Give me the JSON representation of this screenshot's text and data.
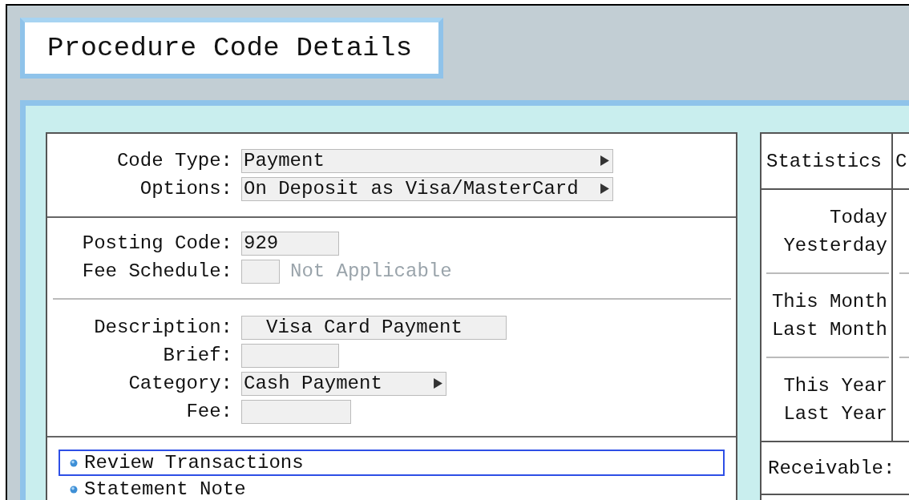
{
  "title": "Procedure Code Details",
  "code_rows": [
    {
      "label": "Code Type:",
      "value": "Payment"
    },
    {
      "label": "Options:",
      "value": "On Deposit as Visa/MasterCard"
    }
  ],
  "posting_rows": [
    {
      "label": "Posting Code:",
      "value": "929"
    },
    {
      "label": "Fee Schedule:",
      "note": "Not Applicable",
      "note_disabled": true
    }
  ],
  "detail_rows": [
    {
      "label": "Description:",
      "kind": "text",
      "value": "Visa Card Payment"
    },
    {
      "label": "Brief:",
      "kind": "text"
    },
    {
      "label": "Category:",
      "kind": "dropdown",
      "value": "Cash Payment"
    },
    {
      "label": "Fee:",
      "kind": "text"
    }
  ],
  "actions": [
    {
      "label": "Review Transactions",
      "selected": true
    },
    {
      "label": "Statement Note",
      "selected": false
    }
  ],
  "statistics": {
    "columns": [
      "Statistics",
      "C"
    ],
    "groups": [
      [
        "Today",
        "Yesterday"
      ],
      [
        "This Month",
        "Last Month"
      ],
      [
        "This Year",
        "Last Year"
      ]
    ],
    "receivable": "Receivable:"
  }
}
